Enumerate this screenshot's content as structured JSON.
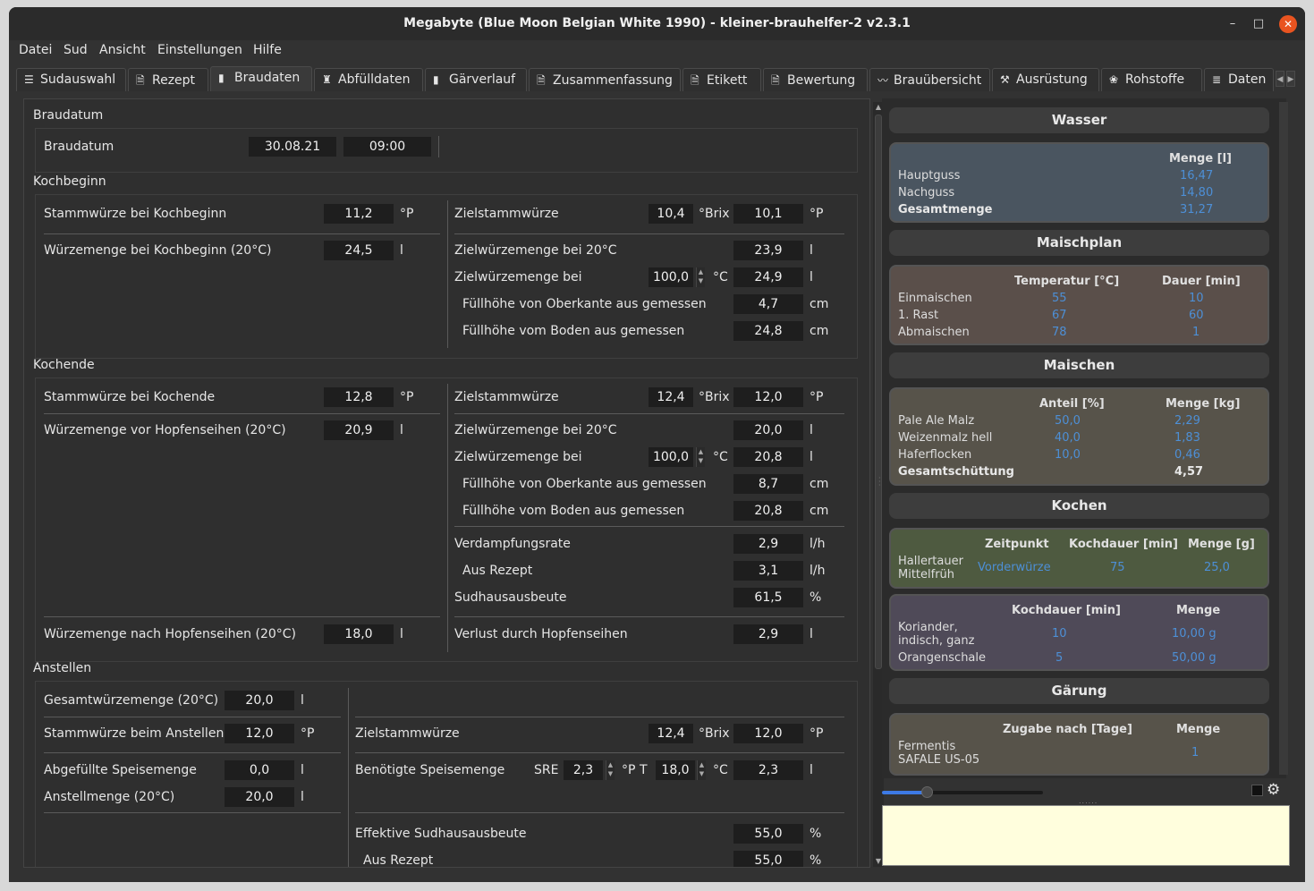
{
  "window": {
    "title": "Megabyte (Blue Moon Belgian White 1990) - kleiner-brauhelfer-2 v2.3.1",
    "minimize": "–",
    "maximize": "□",
    "close": "✕"
  },
  "menu": [
    "Datei",
    "Sud",
    "Ansicht",
    "Einstellungen",
    "Hilfe"
  ],
  "tabs": [
    {
      "icon": "☰",
      "label": "Sudauswahl"
    },
    {
      "icon": "🗎",
      "label": "Rezept"
    },
    {
      "icon": "▮",
      "label": "Braudaten",
      "active": true
    },
    {
      "icon": "♜",
      "label": "Abfülldaten"
    },
    {
      "icon": "▮",
      "label": "Gärverlauf"
    },
    {
      "icon": "🗎",
      "label": "Zusammenfassung"
    },
    {
      "icon": "🗎",
      "label": "Etikett"
    },
    {
      "icon": "🗎",
      "label": "Bewertung"
    },
    {
      "icon": "〰",
      "label": "Brauübersicht"
    },
    {
      "icon": "⚒",
      "label": "Ausrüstung"
    },
    {
      "icon": "❀",
      "label": "Rohstoffe"
    },
    {
      "icon": "≣",
      "label": "Daten"
    }
  ],
  "braudatum": {
    "group": "Braudatum",
    "label": "Braudatum",
    "date": "30.08.21",
    "time": "09:00"
  },
  "kochbeginn": {
    "group": "Kochbeginn",
    "sw_label": "Stammwürze bei Kochbeginn",
    "sw_val": "11,2",
    "sw_unit": "°P",
    "wm_label": "Würzemenge bei Kochbeginn (20°C)",
    "wm_val": "24,5",
    "wm_unit": "l",
    "ziel_label": "Zielstammwürze",
    "ziel_brix": "10,4",
    "brix_unit": "°Brix",
    "ziel_p": "10,1",
    "p_unit": "°P",
    "zwm20_label": "Zielwürzemenge bei 20°C",
    "zwm20_val": "23,9",
    "zwm20_unit": "l",
    "zwm_label": "Zielwürzemenge bei",
    "zwm_temp": "100,0",
    "temp_unit": "°C",
    "zwm_val": "24,9",
    "zwm_unit": "l",
    "fo_label": "Füllhöhe von Oberkante aus gemessen",
    "fo_val": "4,7",
    "fo_unit": "cm",
    "fb_label": "Füllhöhe vom Boden aus gemessen",
    "fb_val": "24,8",
    "fb_unit": "cm"
  },
  "kochende": {
    "group": "Kochende",
    "sw_label": "Stammwürze bei Kochende",
    "sw_val": "12,8",
    "sw_unit": "°P",
    "wm_label": "Würzemenge vor Hopfenseihen (20°C)",
    "wm_val": "20,9",
    "wm_unit": "l",
    "ziel_label": "Zielstammwürze",
    "ziel_brix": "12,4",
    "brix_unit": "°Brix",
    "ziel_p": "12,0",
    "p_unit": "°P",
    "zwm20_label": "Zielwürzemenge bei 20°C",
    "zwm20_val": "20,0",
    "zwm20_unit": "l",
    "zwm_label": "Zielwürzemenge bei",
    "zwm_temp": "100,0",
    "temp_unit": "°C",
    "zwm_val": "20,8",
    "zwm_unit": "l",
    "fo_label": "Füllhöhe von Oberkante aus gemessen",
    "fo_val": "8,7",
    "fo_unit": "cm",
    "fb_label": "Füllhöhe vom Boden aus gemessen",
    "fb_val": "20,8",
    "fb_unit": "cm",
    "vr_label": "Verdampfungsrate",
    "vr_val": "2,9",
    "vr_unit": "l/h",
    "ar_label": "Aus Rezept",
    "ar_val": "3,1",
    "ar_unit": "l/h",
    "sha_label": "Sudhausausbeute",
    "sha_val": "61,5",
    "sha_unit": "%",
    "wmn_label": "Würzemenge nach Hopfenseihen (20°C)",
    "wmn_val": "18,0",
    "wmn_unit": "l",
    "vh_label": "Verlust durch Hopfenseihen",
    "vh_val": "2,9",
    "vh_unit": "l"
  },
  "anstellen": {
    "group": "Anstellen",
    "gwm_label": "Gesamtwürzemenge (20°C)",
    "gwm_val": "20,0",
    "gwm_unit": "l",
    "swa_label": "Stammwürze beim Anstellen",
    "swa_val": "12,0",
    "swa_unit": "°P",
    "asm_label": "Abgefüllte Speisemenge",
    "asm_val": "0,0",
    "asm_unit": "l",
    "am_label": "Anstellmenge (20°C)",
    "am_val": "20,0",
    "am_unit": "l",
    "ziel_label": "Zielstammwürze",
    "ziel_brix": "12,4",
    "brix_unit": "°Brix",
    "ziel_p": "12,0",
    "p_unit": "°P",
    "bsm_label": "Benötigte Speisemenge",
    "sre_label": "SRE",
    "sre_val": "2,3",
    "sre_unit": "°P",
    "t_label": "T",
    "t_val": "18,0",
    "t_unit": "°C",
    "bsm_val": "2,3",
    "bsm_unit": "l",
    "esa_label": "Effektive Sudhausausbeute",
    "esa_val": "55,0",
    "esa_unit": "%",
    "ar_label": "Aus Rezept",
    "ar_val": "55,0",
    "ar_unit": "%"
  },
  "summary": {
    "wasser": {
      "title": "Wasser",
      "col": "Menge [l]",
      "rows": [
        {
          "name": "Hauptguss",
          "val": "16,47"
        },
        {
          "name": "Nachguss",
          "val": "14,80"
        },
        {
          "name": "Gesamtmenge",
          "val": "31,27"
        }
      ],
      "color": "#4a5560"
    },
    "maischplan": {
      "title": "Maischplan",
      "col1": "Temperatur [°C]",
      "col2": "Dauer [min]",
      "rows": [
        {
          "name": "Einmaischen",
          "t": "55",
          "d": "10"
        },
        {
          "name": "1. Rast",
          "t": "67",
          "d": "60"
        },
        {
          "name": "Abmaischen",
          "t": "78",
          "d": "1"
        }
      ],
      "color": "#5a4f4a"
    },
    "maischen": {
      "title": "Maischen",
      "col1": "Anteil [%]",
      "col2": "Menge [kg]",
      "rows": [
        {
          "name": "Pale Ale Malz",
          "a": "50,0",
          "m": "2,29"
        },
        {
          "name": "Weizenmalz hell",
          "a": "40,0",
          "m": "1,83"
        },
        {
          "name": "Haferflocken",
          "a": "10,0",
          "m": "0,46"
        }
      ],
      "total_name": "Gesamtschüttung",
      "total_val": "4,57",
      "color": "#57534a"
    },
    "kochen": {
      "title": "Kochen",
      "hop_cols": [
        "Zeitpunkt",
        "Kochdauer [min]",
        "Menge [g]"
      ],
      "hop": {
        "name1": "Hallertauer",
        "name2": "Mittelfrüh",
        "zeit": "Vorderwürze",
        "dauer": "75",
        "menge": "25,0"
      },
      "hop_color": "#4e5a40",
      "add_cols": [
        "Kochdauer [min]",
        "Menge"
      ],
      "adds": [
        {
          "name1": "Koriander,",
          "name2": "indisch, ganz",
          "dauer": "10",
          "menge": "10,00 g"
        },
        {
          "name1": "Orangenschale",
          "name2": "",
          "dauer": "5",
          "menge": "50,00 g"
        }
      ],
      "add_color": "#4f4a58"
    },
    "gaerung": {
      "title": "Gärung",
      "col1": "Zugabe nach [Tage]",
      "col2": "Menge",
      "yeast1": "Fermentis",
      "yeast2": "SAFALE US-05",
      "menge": "1",
      "color": "#57534a"
    }
  }
}
